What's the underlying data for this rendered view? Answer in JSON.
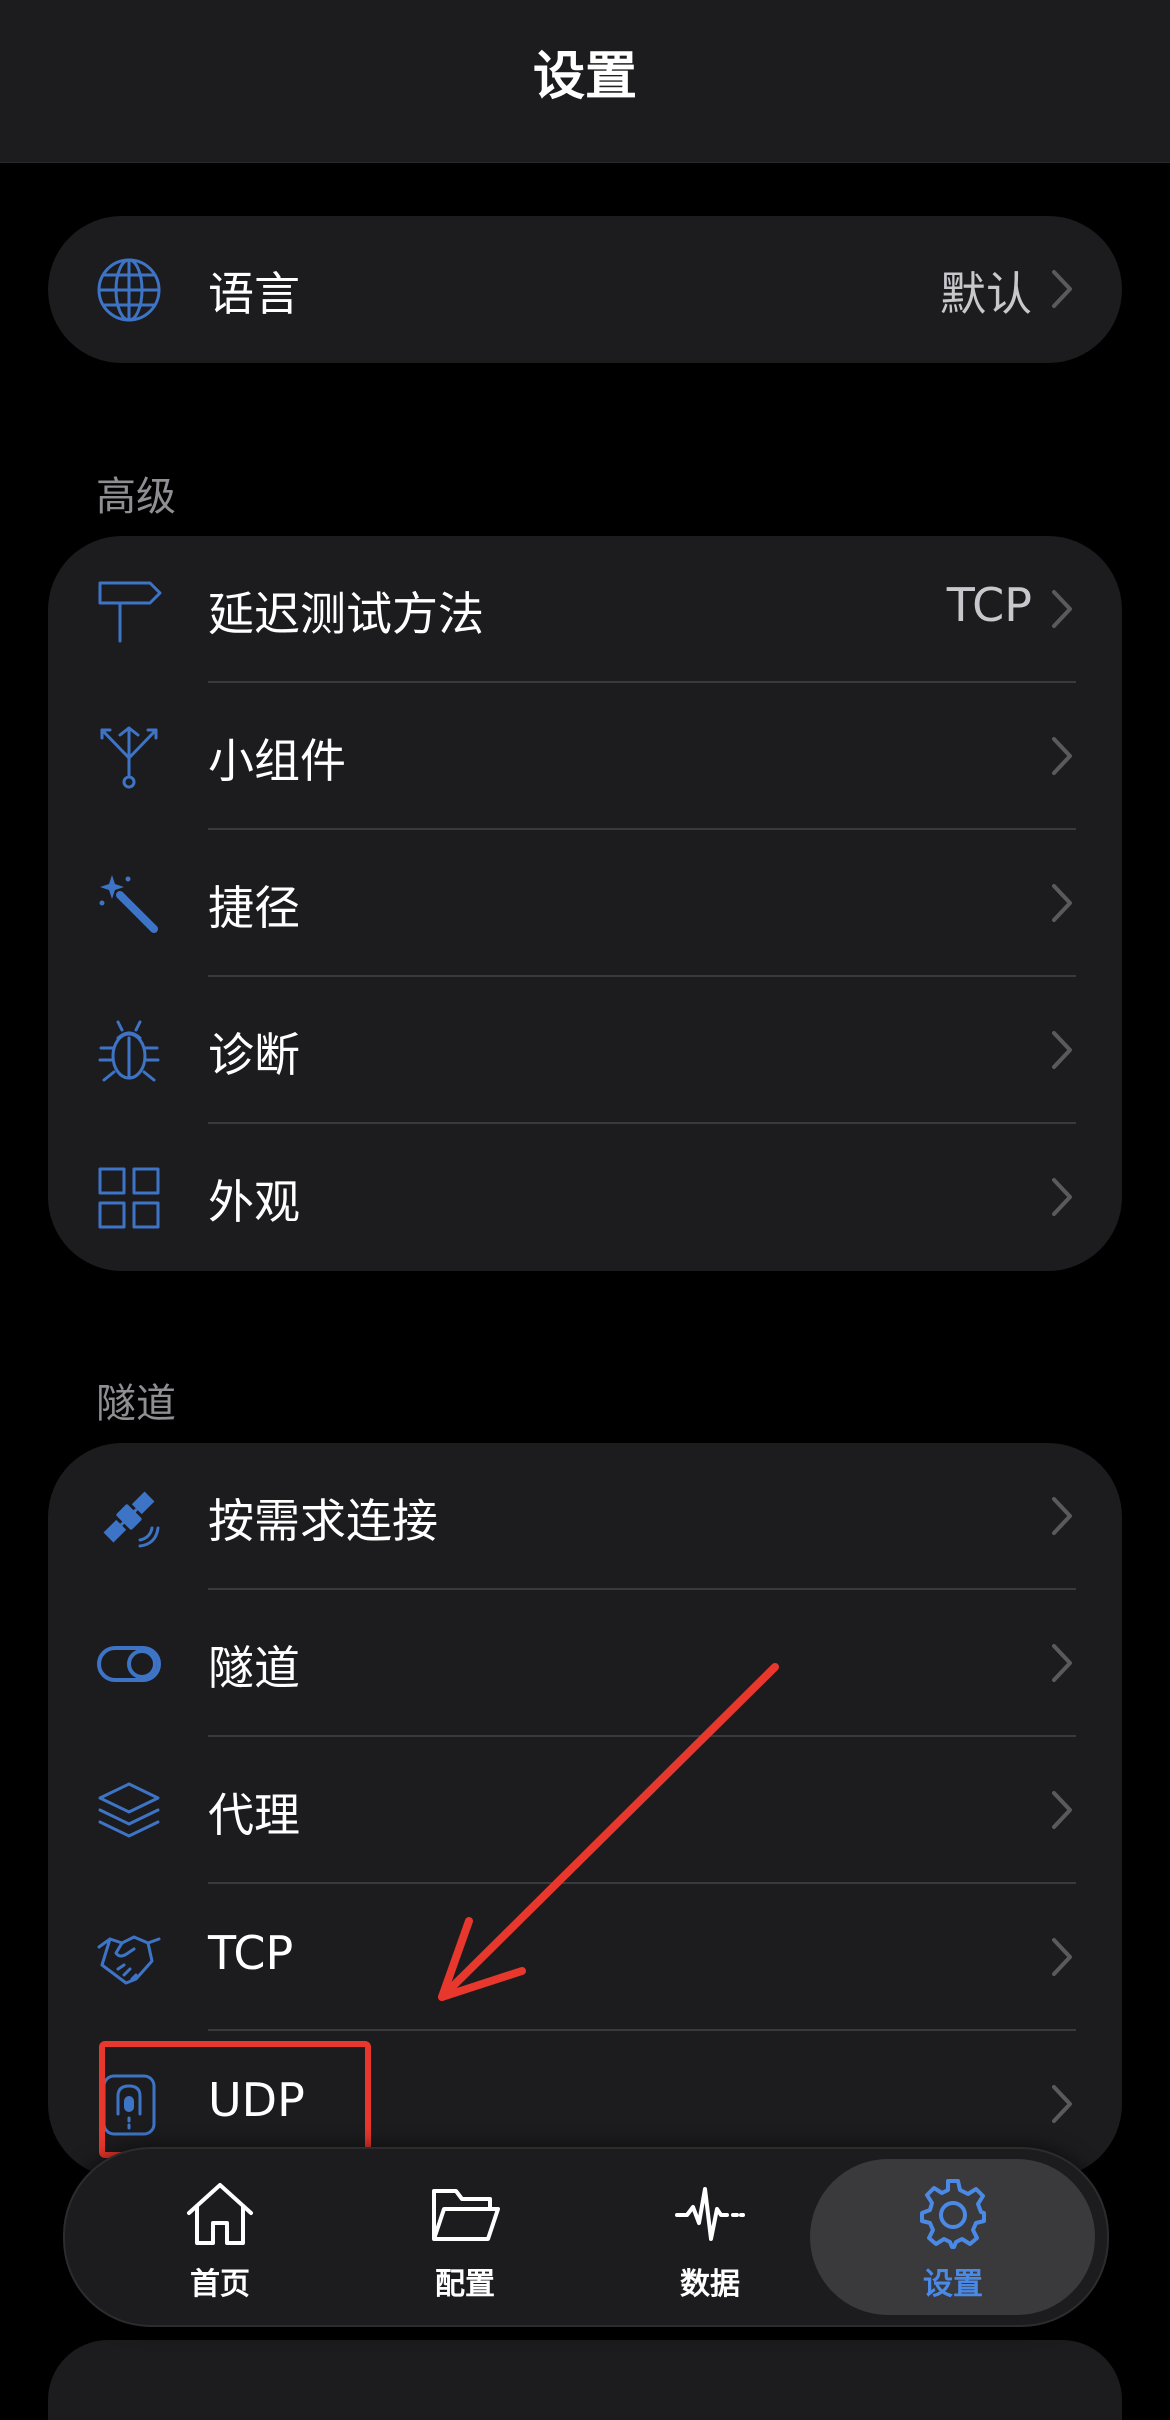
{
  "navbar": {
    "title": "设置"
  },
  "language": {
    "label": "语言",
    "value": "默认",
    "icon": "globe-icon"
  },
  "advanced": {
    "header": "高级",
    "items": [
      {
        "label": "延迟测试方法",
        "value": "TCP",
        "icon": "signpost-icon"
      },
      {
        "label": "小组件",
        "value": "",
        "icon": "fork-icon"
      },
      {
        "label": "捷径",
        "value": "",
        "icon": "magic-wand-icon"
      },
      {
        "label": "诊断",
        "value": "",
        "icon": "bug-icon"
      },
      {
        "label": "外观",
        "value": "",
        "icon": "grid-icon"
      }
    ]
  },
  "tunnel": {
    "header": "隧道",
    "items": [
      {
        "label": "按需求连接",
        "value": "",
        "icon": "satellite-icon"
      },
      {
        "label": "隧道",
        "value": "",
        "icon": "toggle-icon"
      },
      {
        "label": "代理",
        "value": "",
        "icon": "layers-icon"
      },
      {
        "label": "TCP",
        "value": "",
        "icon": "handshake-icon"
      },
      {
        "label": "UDP",
        "value": "",
        "icon": "zipper-icon"
      }
    ]
  },
  "tabbar": {
    "tabs": [
      {
        "label": "首页",
        "icon": "home-icon",
        "active": false
      },
      {
        "label": "配置",
        "icon": "folder-icon",
        "active": false
      },
      {
        "label": "数据",
        "icon": "pulse-icon",
        "active": false
      },
      {
        "label": "设置",
        "icon": "gear-icon",
        "active": true
      }
    ]
  },
  "colors": {
    "accent": "#3e74c6",
    "active_tab": "#4a8ae6",
    "annotation": "#e8372c",
    "background": "#000000",
    "card": "#1c1c1e"
  }
}
